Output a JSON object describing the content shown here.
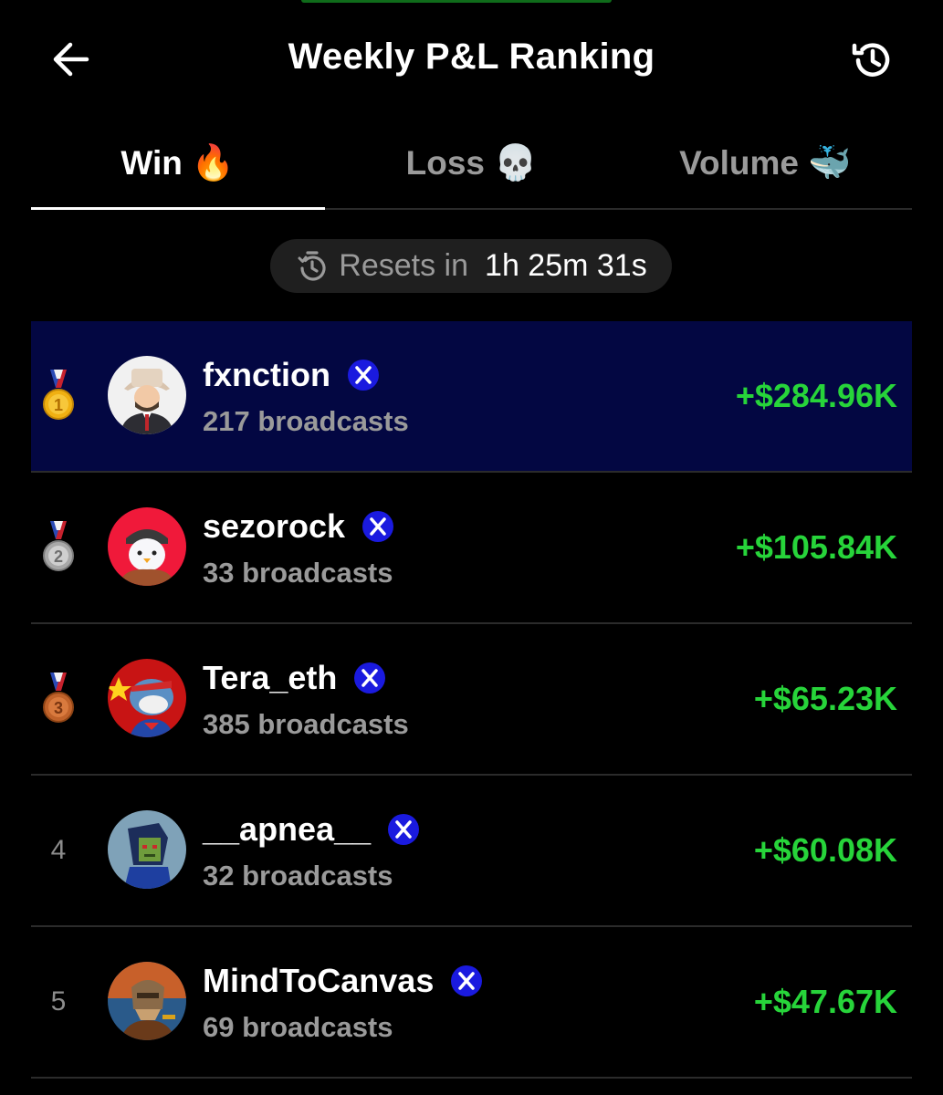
{
  "header": {
    "title": "Weekly P&L Ranking",
    "back_icon": "arrow-left-icon",
    "history_icon": "history-clock-icon"
  },
  "tabs": [
    {
      "label": "Win",
      "emoji": "🔥",
      "active": true
    },
    {
      "label": "Loss",
      "emoji": "💀",
      "active": false
    },
    {
      "label": "Volume",
      "emoji": "🐳",
      "active": false
    }
  ],
  "reset": {
    "icon": "timer-icon",
    "label": "Resets in",
    "time": "1h 25m 31s"
  },
  "rankings": [
    {
      "rank": "1",
      "medal": "gold",
      "name": "fxnction",
      "broadcasts": "217 broadcasts",
      "pnl": "+$284.96K",
      "highlight": true
    },
    {
      "rank": "2",
      "medal": "silver",
      "name": "sezorock",
      "broadcasts": "33 broadcasts",
      "pnl": "+$105.84K",
      "highlight": false
    },
    {
      "rank": "3",
      "medal": "bronze",
      "name": "Tera_eth",
      "broadcasts": "385 broadcasts",
      "pnl": "+$65.23K",
      "highlight": false
    },
    {
      "rank": "4",
      "medal": "",
      "name": "__apnea__",
      "broadcasts": "32 broadcasts",
      "pnl": "+$60.08K",
      "highlight": false
    },
    {
      "rank": "5",
      "medal": "",
      "name": "MindToCanvas",
      "broadcasts": "69 broadcasts",
      "pnl": "+$47.67K",
      "highlight": false
    }
  ],
  "colors": {
    "background": "#000000",
    "highlight_row": "#030742",
    "pnl_positive": "#27d43a",
    "verified_badge": "#1a1adf",
    "muted_text": "#9a9a9a"
  }
}
